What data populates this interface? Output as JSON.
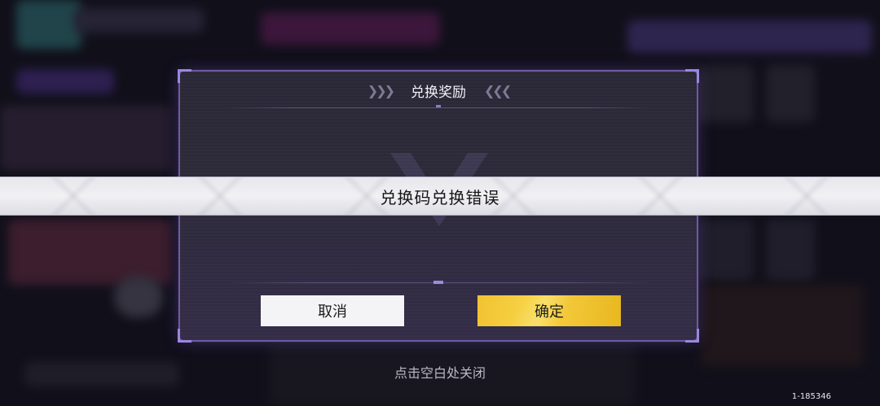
{
  "dialog": {
    "title": "兑换奖励",
    "title_left_icon": "triple-chevron-right",
    "title_right_icon": "triple-chevron-left",
    "cancel_label": "取消",
    "confirm_label": "确定"
  },
  "toast": {
    "message": "兑换码兑换错误"
  },
  "hint": "点击空白处关闭",
  "id_tag": "1-185346",
  "colors": {
    "dialog_border": "#6e5aa3",
    "confirm_button": "#f5cf3c",
    "cancel_button": "#f4f4f6",
    "toast_bg": "#ececf0"
  }
}
